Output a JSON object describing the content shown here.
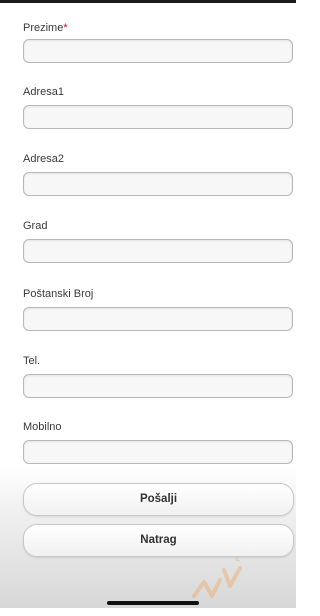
{
  "form": {
    "fields": [
      {
        "label": "Prezime",
        "required_mark": "*",
        "value": ""
      },
      {
        "label": "Adresa1",
        "value": ""
      },
      {
        "label": "Adresa2",
        "value": ""
      },
      {
        "label": "Grad",
        "value": ""
      },
      {
        "label": "Poštanski Broj",
        "value": ""
      },
      {
        "label": "Tel.",
        "value": ""
      },
      {
        "label": "Mobilno",
        "value": ""
      }
    ]
  },
  "actions": {
    "submit_label": "Pošalji",
    "back_label": "Natrag"
  },
  "colors": {
    "required_star": "#d0021b",
    "watermark": "#f29a4a"
  },
  "icons": {
    "watermark": "watermark-logo-icon"
  }
}
